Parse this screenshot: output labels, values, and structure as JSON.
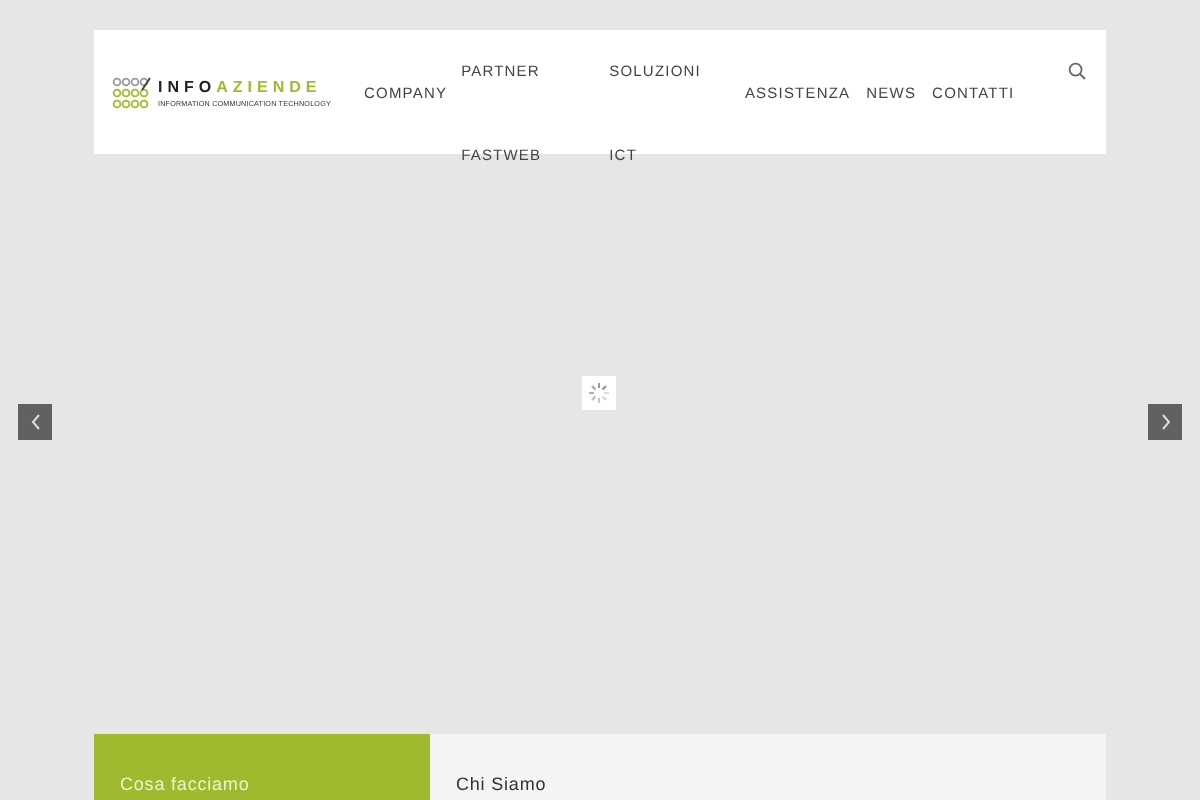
{
  "logo": {
    "word_1": "INFO",
    "word_2": "AZIENDE",
    "tagline": "INFORMATION COMMUNICATION TECHNOLOGY"
  },
  "nav": [
    {
      "label": "COMPANY"
    },
    {
      "label": "PARTNER",
      "children": [
        {
          "label": "FASTWEB"
        }
      ]
    },
    {
      "label": "SOLUZIONI",
      "children": [
        {
          "label": "ICT"
        }
      ]
    },
    {
      "label": "ASSISTENZA"
    },
    {
      "label": "NEWS"
    },
    {
      "label": "CONTATTI"
    }
  ],
  "panels": [
    {
      "title": "Cosa facciamo",
      "kind": "accent"
    },
    {
      "title": "Chi Siamo",
      "kind": "plain"
    }
  ]
}
